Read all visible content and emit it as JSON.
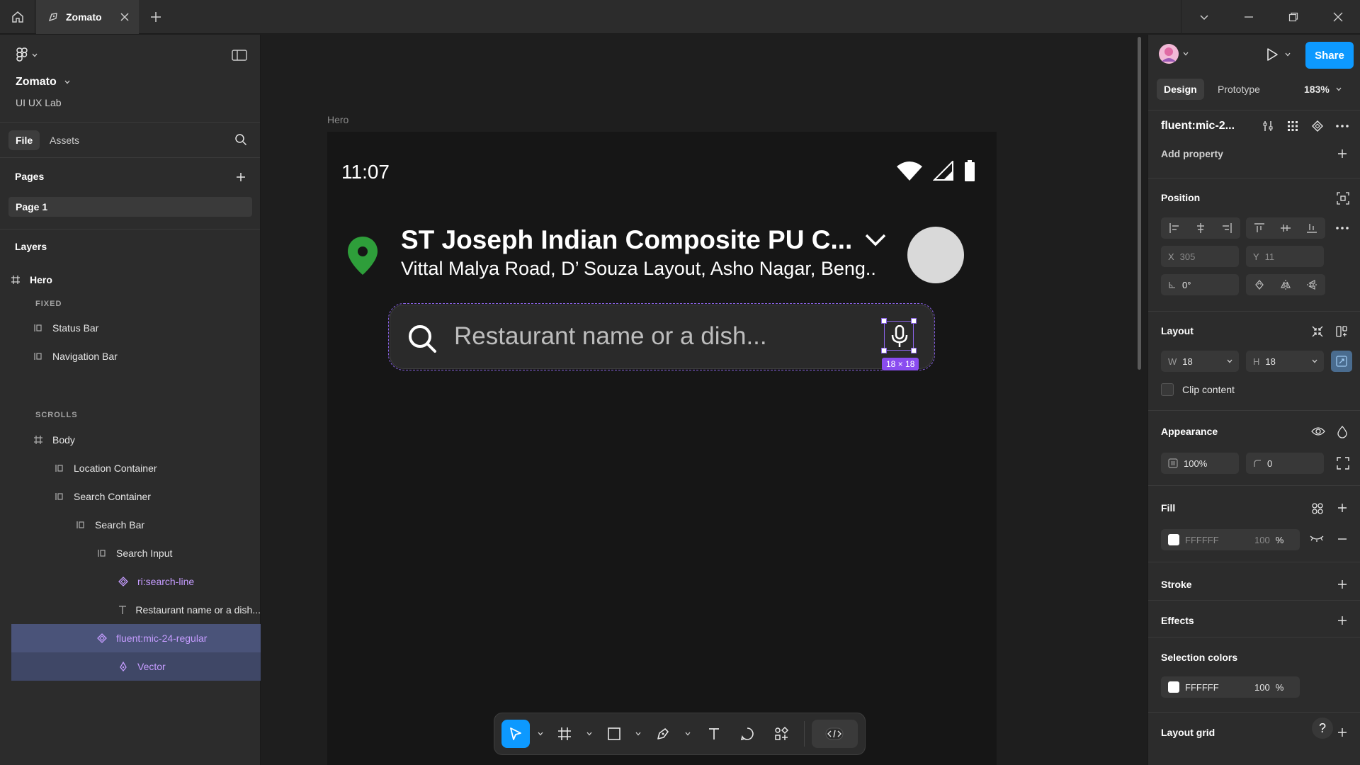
{
  "titlebar": {
    "tab_title": "Zomato"
  },
  "left_panel": {
    "file_name": "Zomato",
    "team_name": "UI UX Lab",
    "tab_file": "File",
    "tab_assets": "Assets",
    "pages_title": "Pages",
    "current_page": "Page 1",
    "layers_title": "Layers",
    "layers": [
      {
        "label": "Hero"
      },
      {
        "label": "FIXED"
      },
      {
        "label": "Status Bar"
      },
      {
        "label": "Navigation Bar"
      },
      {
        "label": "SCROLLS"
      },
      {
        "label": "Body"
      },
      {
        "label": "Location Container"
      },
      {
        "label": "Search Container"
      },
      {
        "label": "Search Bar"
      },
      {
        "label": "Search Input"
      },
      {
        "label": "ri:search-line"
      },
      {
        "label": "Restaurant name or a dish..."
      },
      {
        "label": "fluent:mic-24-regular"
      },
      {
        "label": "Vector"
      }
    ]
  },
  "canvas": {
    "frame_label": "Hero",
    "phone": {
      "time": "11:07",
      "location_title": "ST Joseph Indian Composite PU C...",
      "location_subtitle": "Vittal Malya Road, D’ Souza Layout, Asho Nagar, Beng..",
      "search_placeholder": "Restaurant name or a dish...",
      "selection_size": "18 × 18"
    }
  },
  "right_panel": {
    "share_label": "Share",
    "tab_design": "Design",
    "tab_prototype": "Prototype",
    "zoom": "183%",
    "selected_name": "fluent:mic-2...",
    "add_property": "Add property",
    "position_title": "Position",
    "x_label": "X",
    "x_value": "305",
    "y_label": "Y",
    "y_value": "11",
    "rotation": "0°",
    "layout_title": "Layout",
    "w_label": "W",
    "w_value": "18",
    "h_label": "H",
    "h_value": "18",
    "clip_content": "Clip content",
    "appearance_title": "Appearance",
    "opacity": "100%",
    "radius": "0",
    "fill_title": "Fill",
    "fill_hex": "FFFFFF",
    "fill_opacity": "100",
    "percent": "%",
    "stroke_title": "Stroke",
    "effects_title": "Effects",
    "selection_colors_title": "Selection colors",
    "sel_hex": "FFFFFF",
    "sel_opacity": "100",
    "layout_grid_title": "Layout grid",
    "help": "?"
  },
  "colors": {
    "accent": "#0d99ff",
    "selection": "#8a63e6",
    "component": "#c59cff",
    "pin_green": "#2e9e3a"
  }
}
